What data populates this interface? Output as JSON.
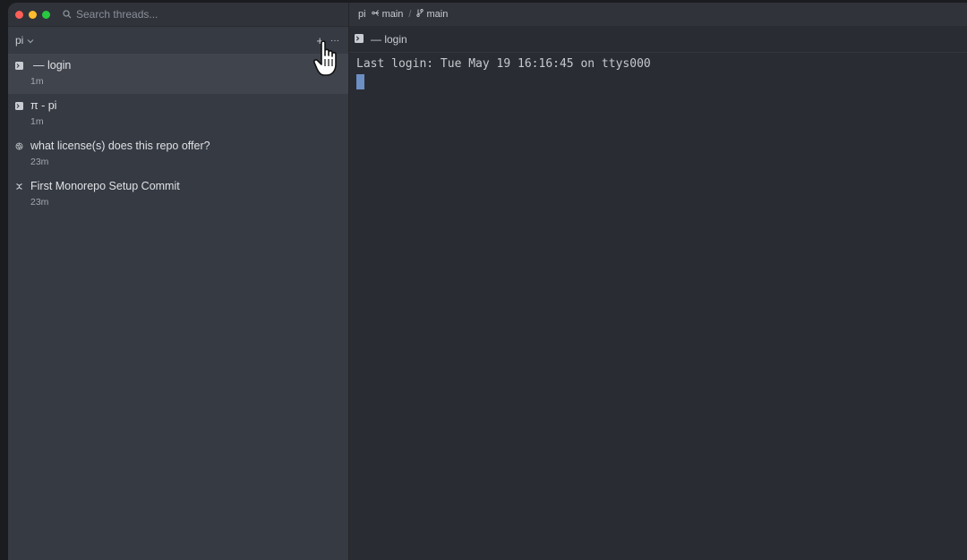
{
  "sidebar": {
    "search_placeholder": "Search threads...",
    "project": {
      "name": "pi",
      "add_label": "+",
      "more_label": "···"
    },
    "threads": [
      {
        "title": "— login",
        "time": "1m",
        "icon": "terminal-icon",
        "active": true
      },
      {
        "title": "π - pi",
        "time": "1m",
        "icon": "terminal-icon",
        "active": false
      },
      {
        "title": "what license(s) does this repo offer?",
        "time": "23m",
        "icon": "openai-icon",
        "active": false
      },
      {
        "title": "First Monorepo Setup Commit",
        "time": "23m",
        "icon": "agent-icon",
        "active": false
      }
    ]
  },
  "header": {
    "project": "pi",
    "worktree": "main",
    "branch": "main"
  },
  "tab": {
    "title": "— login"
  },
  "terminal": {
    "line1": "Last login: Tue May 19 16:16:45 on ttys000"
  },
  "colors": {
    "cursor": "#6c8fc4",
    "close": "#ff5f57",
    "minimize": "#febc2e",
    "maximize": "#28c840"
  }
}
